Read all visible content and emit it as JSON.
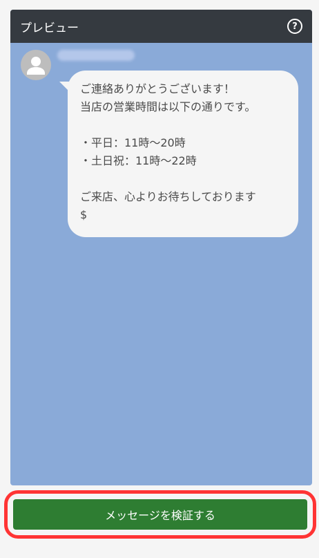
{
  "header": {
    "title": "プレビュー",
    "help_icon": "help-icon"
  },
  "chat": {
    "sender_avatar_icon": "user-avatar-icon",
    "message": "ご連絡ありがとうございます！\n当店の営業時間は以下の通りです。\n\n・平日：11時〜20時\n・土日祝：11時〜22時\n\nご来店、心よりお待ちしております\n$"
  },
  "footer": {
    "verify_button_label": "メッセージを検証する"
  },
  "colors": {
    "header_bg": "#353a40",
    "chat_bg": "#8aaad8",
    "bubble_bg": "#f5f5f5",
    "button_bg": "#2e7d32",
    "highlight_border": "#ff3434"
  }
}
